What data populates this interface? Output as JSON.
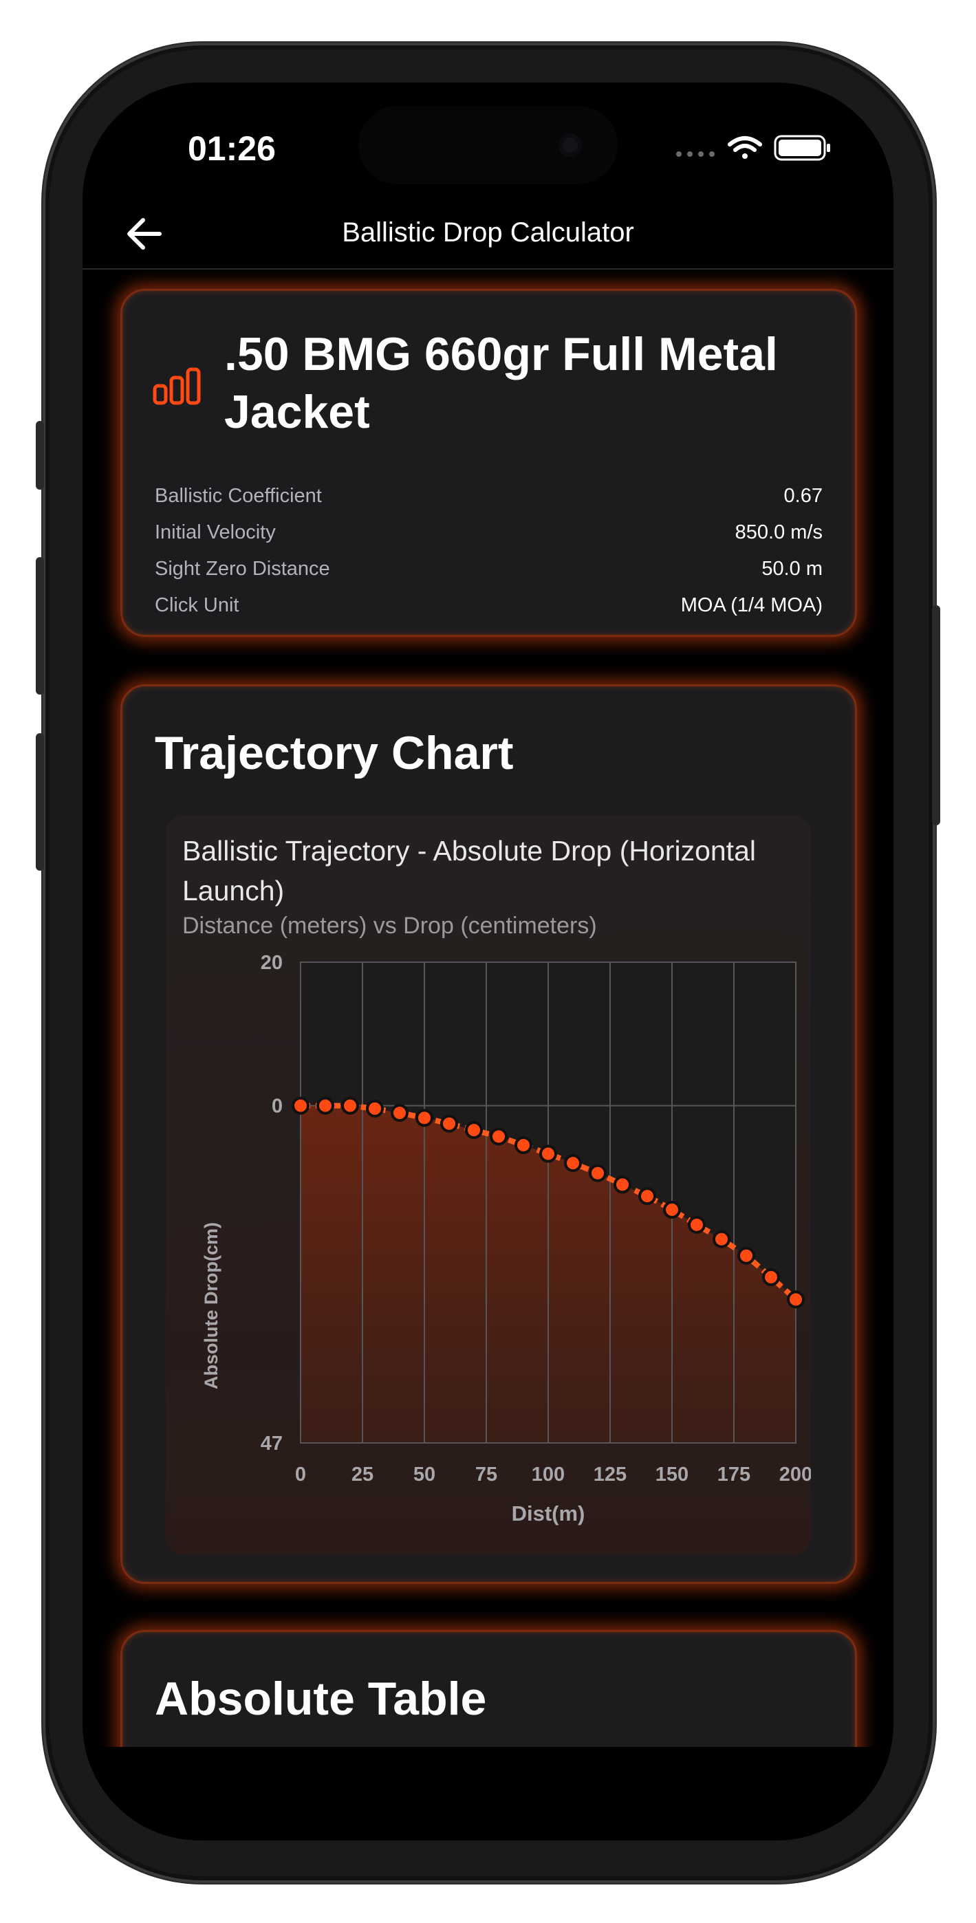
{
  "status_bar": {
    "time": "01:26"
  },
  "nav": {
    "title": "Ballistic Drop Calculator"
  },
  "ammo": {
    "name": ".50 BMG 660gr Full Metal Jacket",
    "specs": [
      {
        "label": "Ballistic Coefficient",
        "value": "0.67"
      },
      {
        "label": "Initial Velocity",
        "value": "850.0 m/s"
      },
      {
        "label": "Sight Zero Distance",
        "value": "50.0 m"
      },
      {
        "label": "Click Unit",
        "value": "MOA (1/4 MOA)"
      }
    ]
  },
  "trajectory": {
    "section_title": "Trajectory Chart"
  },
  "absolute_table": {
    "section_title": "Absolute Table"
  },
  "colors": {
    "accent": "#ff5a1f",
    "card_bg": "#1c1c1e",
    "glow": "#c43a0a"
  },
  "chart_data": {
    "type": "area",
    "title": "Ballistic Trajectory - Absolute Drop (Horizontal Launch)",
    "subtitle": "Distance (meters) vs Drop (centimeters)",
    "xlabel": "Dist(m)",
    "ylabel": "Absolute Drop(cm)",
    "xlim": [
      0,
      200
    ],
    "ylim": [
      20,
      -47
    ],
    "x_ticks": [
      "0",
      "25",
      "50",
      "75",
      "100",
      "125",
      "150",
      "175",
      "200"
    ],
    "y_ticks": [
      {
        "value": 20,
        "label": "20"
      },
      {
        "value": 0,
        "label": "0"
      },
      {
        "value": -47,
        "label": "47"
      }
    ],
    "grid": true,
    "x": [
      0,
      10,
      20,
      30,
      40,
      50,
      60,
      70,
      80,
      90,
      100,
      110,
      120,
      130,
      140,
      150,
      160,
      170,
      180,
      190,
      200
    ],
    "y": [
      0,
      0,
      0,
      -0.4,
      -1.0,
      -1.7,
      -2.5,
      -3.4,
      -4.3,
      -5.5,
      -6.7,
      -8.0,
      -9.4,
      -11.0,
      -12.6,
      -14.5,
      -16.6,
      -18.6,
      -20.9,
      -23.9,
      -27.0
    ]
  }
}
